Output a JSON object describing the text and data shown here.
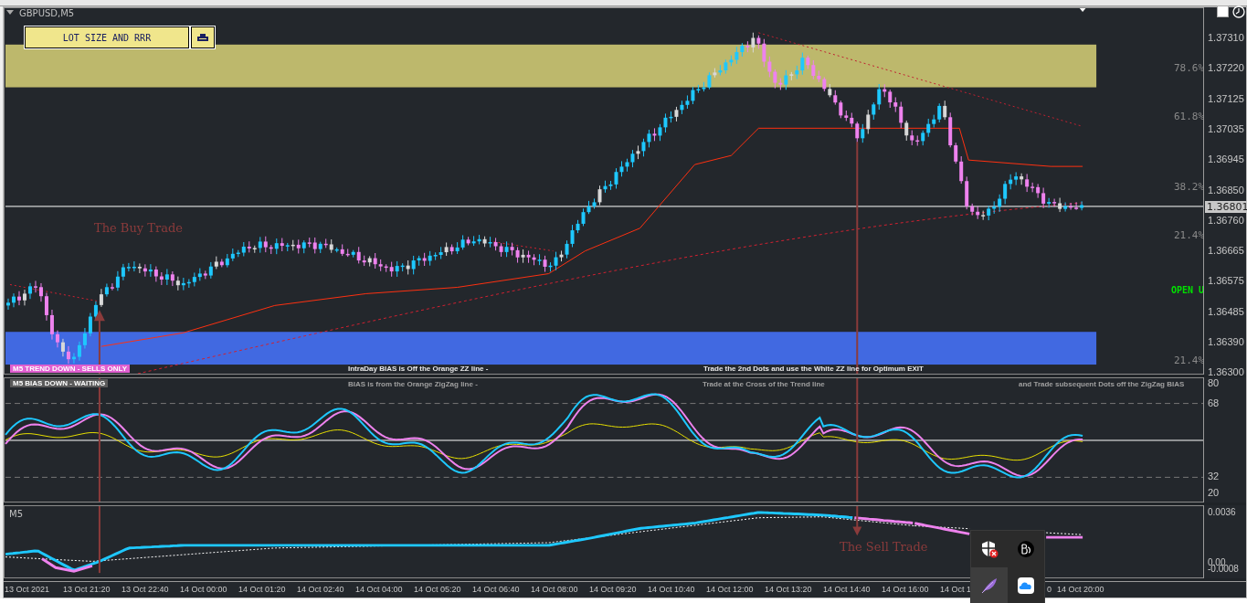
{
  "chart": {
    "title": "GBPUSD,M5",
    "lot_button": "LOT SIZE AND RRR",
    "price_axis": [
      "1.37310",
      "1.37220",
      "1.37125",
      "1.37035",
      "1.36945",
      "1.36850",
      "1.36760",
      "1.36665",
      "1.36575",
      "1.36485",
      "1.36390",
      "1.36300"
    ],
    "current_price": "1.36801",
    "fib_levels": [
      {
        "label": "78.6%"
      },
      {
        "label": "61.8%"
      },
      {
        "label": "38.2%"
      },
      {
        "label": "21.4%"
      },
      {
        "label": "21.4%"
      }
    ],
    "open_label": "OPEN U",
    "annotations": [
      {
        "text": "The Buy Trade"
      },
      {
        "text": "The Sell Trade"
      }
    ],
    "trend_badge": "M5  TREND DOWN - SELLS ONLY",
    "notes": [
      "IntraDay BIAS is Off the Orange ZZ line -",
      "Trade the 2nd Dots and use the White ZZ line for Optimum EXIT"
    ]
  },
  "oscillator": {
    "bias_badge": "M5  BIAS DOWN - WAITING",
    "notes": [
      "BIAS is from the Orange ZigZag line -",
      "Trade at the Cross of the Trend line",
      "and Trade subsequent Dots off the ZigZag BIAS"
    ],
    "axis": [
      "80",
      "68",
      "32",
      "20"
    ]
  },
  "lower_pane": {
    "title": "M5",
    "axis": [
      "0.0036",
      "0.00",
      "-0.0008"
    ]
  },
  "time_axis": [
    {
      "label": "13 Oct 2021",
      "kind": "tick"
    },
    {
      "label": "13 Oct 21:20",
      "kind": "tick"
    },
    {
      "label": "13 Oct 22:40",
      "kind": "tick"
    },
    {
      "label": "14 Oct 00:00",
      "kind": "tick"
    },
    {
      "label": "14 Oct 01:20",
      "kind": "tick"
    },
    {
      "label": "14 Oct 02:40",
      "kind": "tick"
    },
    {
      "label": "14 Oct 04:00",
      "kind": "tick"
    },
    {
      "label": "14 Oct 05:20",
      "kind": "tick"
    },
    {
      "label": "14 Oct 06:40",
      "kind": "tick"
    },
    {
      "label": "14 Oct 08:00",
      "kind": "tick"
    },
    {
      "label": "14 Oct 09:20",
      "kind": "tick"
    },
    {
      "label": "14 Oct 10:40",
      "kind": "tick"
    },
    {
      "label": "14 Oct 12:00",
      "kind": "tick"
    },
    {
      "label": "14 Oct 13:20",
      "kind": "tick"
    },
    {
      "label": "14 Oct 14:40",
      "kind": "tick"
    },
    {
      "label": "14 Oct 16:00",
      "kind": "tick"
    },
    {
      "label": "14 Oct 1",
      "kind": "tick"
    },
    {
      "label": "0",
      "kind": "tail"
    },
    {
      "label": "14 Oct 20:00",
      "kind": "tick"
    }
  ],
  "tray": {
    "icons": [
      {
        "kind": "shield",
        "selected": false
      },
      {
        "kind": "badge",
        "selected": false
      },
      {
        "kind": "feather",
        "selected": true
      },
      {
        "kind": "cloud",
        "selected": false
      }
    ]
  }
}
